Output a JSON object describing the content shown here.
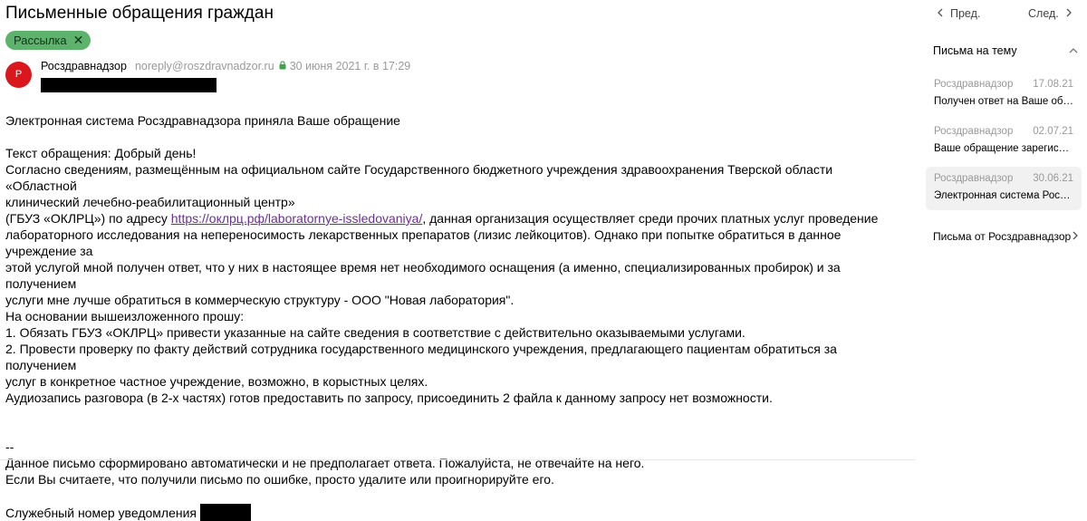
{
  "message": {
    "subject": "Письменные обращения граждан",
    "label": "Рассылка",
    "avatar_letter": "Р",
    "sender_name": "Росздравнадзор",
    "sender_email": "noreply@roszdravnadzor.ru",
    "date": "30 июня 2021 г. в 17:29"
  },
  "body": {
    "line1": "Электронная система Росздравнадзора приняла Ваше обращение",
    "line2": "Текст обращения: Добрый день!",
    "line3": "Согласно сведениям, размещённым на официальном сайте Государственного бюджетного учреждения здравоохранения Тверской области «Областной",
    "line4": "клинический лечебно-реабилитационный центр»",
    "line5_before": "(ГБУЗ «ОКЛРЦ») по адресу ",
    "link": "https://оклрц.рф/laboratornye-issledovaniya/",
    "line5_after": ", данная организация осуществляет среди прочих платных услуг проведение",
    "line6": "лабораторного исследования на непереносимость лекарственных препаратов (лизис лейкоцитов). Однако при попытке обратиться в данное учреждение за",
    "line7": "этой услугой мной получен ответ, что у них в настоящее время нет необходимого оснащения (а именно, специализированных пробирок) и за получением",
    "line8": "услуги мне лучше обратиться в коммерческую структуру - ООО \"Новая лаборатория\".",
    "line9": "На основании вышеизложенного прошу:",
    "line10": "1. Обязать ГБУЗ «ОКЛРЦ» привести указанные на сайте сведения в соответствие с действительно оказываемыми услугами.",
    "line11": "2. Провести проверку по факту действий сотрудника государственного медицинского учреждения, предлагающего пациентам обратиться за получением",
    "line12": "услуг в конкретное частное учреждение, возможно, в корыстных целях.",
    "line13": "Аудиозапись разговора (в 2-х частях) готов предоставить по запросу, присоединить 2 файла к данному запросу нет возможности.",
    "signature_sep": "--",
    "footer1": "Данное письмо сформировано автоматически и не предполагает ответа. Пожалуйста, не отвечайте на него.",
    "footer2": "Если Вы считаете, что получили письмо по ошибке, просто удалите или проигнорируйте его.",
    "service_number_label": "Служебный номер уведомления"
  },
  "sidebar": {
    "prev_label": "Пред.",
    "next_label": "След.",
    "thread_title": "Письма на тему",
    "thread_items": [
      {
        "sender": "Росздравнадзор",
        "date": "17.08.21",
        "subject": "Получен ответ на Ваше обращение"
      },
      {
        "sender": "Росздравнадзор",
        "date": "02.07.21",
        "subject": "Ваше обращение зарегистрировано"
      },
      {
        "sender": "Росздравнадзор",
        "date": "30.06.21",
        "subject": "Электронная система Росздравнадзора"
      }
    ],
    "from_sender": "Письма от Росздравнадзор"
  },
  "colors": {
    "label_bg": "#5db36b",
    "avatar_bg": "#d9171d",
    "link": "#6a2e98",
    "lock": "#3fa34d"
  }
}
